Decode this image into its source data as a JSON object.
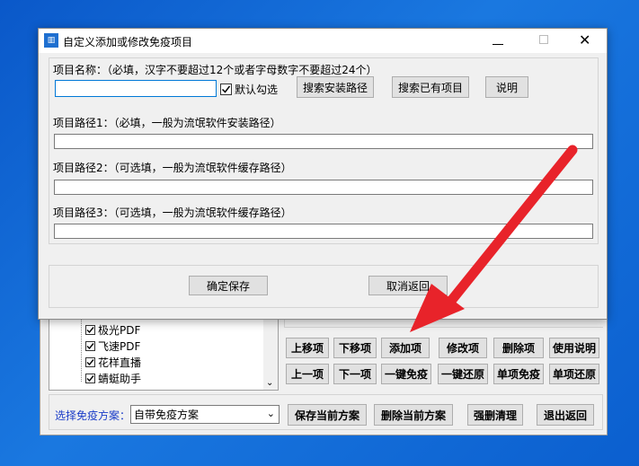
{
  "dialog": {
    "title": "自定义添加或修改免疫项目",
    "name_label": "项目名称：（必填，汉字不要超过12个或者字母数字不要超过24个）",
    "name_value": "",
    "default_check_label": "默认勾选",
    "search_install_btn": "搜索安装路径",
    "search_existing_btn": "搜索已有项目",
    "help_btn": "说明",
    "path1_label": "项目路径1：（必填，一般为流氓软件安装路径）",
    "path2_label": "项目路径2：（可选填，一般为流氓软件缓存路径）",
    "path3_label": "项目路径3：（可选填，一般为流氓软件缓存路径）",
    "path1_value": "",
    "path2_value": "",
    "path3_value": "",
    "save_btn": "确定保存",
    "cancel_btn": "取消返回"
  },
  "main": {
    "tree_items": [
      "极光PDF",
      "飞速PDF",
      "花样直播",
      "蜻蜓助手"
    ],
    "buttons_row1": [
      "上移项",
      "下移项",
      "添加项",
      "修改项",
      "删除项",
      "使用说明"
    ],
    "buttons_row2": [
      "上一项",
      "下一项",
      "一键免疫",
      "一键还原",
      "单项免疫",
      "单项还原"
    ],
    "scheme_label": "选择免疫方案：",
    "scheme_value": "自带免疫方案",
    "save_scheme_btn": "保存当前方案",
    "delete_scheme_btn": "删除当前方案",
    "force_clean_btn": "强删清理",
    "exit_btn": "退出返回"
  },
  "colors": {
    "arrow": "#e8232a",
    "scheme_label": "#1a3cc8",
    "titlebar": "#ffffff"
  }
}
